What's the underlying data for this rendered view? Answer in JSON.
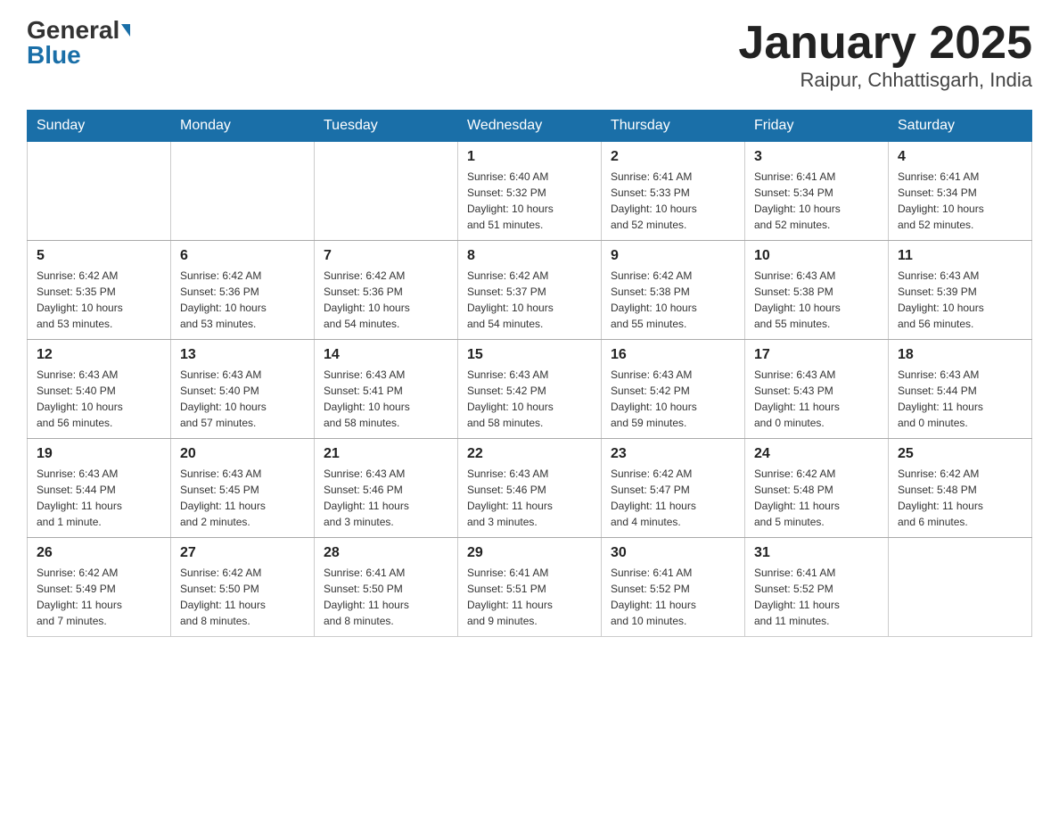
{
  "header": {
    "logo_general": "General",
    "logo_blue": "Blue",
    "title": "January 2025",
    "subtitle": "Raipur, Chhattisgarh, India"
  },
  "weekdays": [
    "Sunday",
    "Monday",
    "Tuesday",
    "Wednesday",
    "Thursday",
    "Friday",
    "Saturday"
  ],
  "weeks": [
    [
      {
        "day": "",
        "info": ""
      },
      {
        "day": "",
        "info": ""
      },
      {
        "day": "",
        "info": ""
      },
      {
        "day": "1",
        "info": "Sunrise: 6:40 AM\nSunset: 5:32 PM\nDaylight: 10 hours\nand 51 minutes."
      },
      {
        "day": "2",
        "info": "Sunrise: 6:41 AM\nSunset: 5:33 PM\nDaylight: 10 hours\nand 52 minutes."
      },
      {
        "day": "3",
        "info": "Sunrise: 6:41 AM\nSunset: 5:34 PM\nDaylight: 10 hours\nand 52 minutes."
      },
      {
        "day": "4",
        "info": "Sunrise: 6:41 AM\nSunset: 5:34 PM\nDaylight: 10 hours\nand 52 minutes."
      }
    ],
    [
      {
        "day": "5",
        "info": "Sunrise: 6:42 AM\nSunset: 5:35 PM\nDaylight: 10 hours\nand 53 minutes."
      },
      {
        "day": "6",
        "info": "Sunrise: 6:42 AM\nSunset: 5:36 PM\nDaylight: 10 hours\nand 53 minutes."
      },
      {
        "day": "7",
        "info": "Sunrise: 6:42 AM\nSunset: 5:36 PM\nDaylight: 10 hours\nand 54 minutes."
      },
      {
        "day": "8",
        "info": "Sunrise: 6:42 AM\nSunset: 5:37 PM\nDaylight: 10 hours\nand 54 minutes."
      },
      {
        "day": "9",
        "info": "Sunrise: 6:42 AM\nSunset: 5:38 PM\nDaylight: 10 hours\nand 55 minutes."
      },
      {
        "day": "10",
        "info": "Sunrise: 6:43 AM\nSunset: 5:38 PM\nDaylight: 10 hours\nand 55 minutes."
      },
      {
        "day": "11",
        "info": "Sunrise: 6:43 AM\nSunset: 5:39 PM\nDaylight: 10 hours\nand 56 minutes."
      }
    ],
    [
      {
        "day": "12",
        "info": "Sunrise: 6:43 AM\nSunset: 5:40 PM\nDaylight: 10 hours\nand 56 minutes."
      },
      {
        "day": "13",
        "info": "Sunrise: 6:43 AM\nSunset: 5:40 PM\nDaylight: 10 hours\nand 57 minutes."
      },
      {
        "day": "14",
        "info": "Sunrise: 6:43 AM\nSunset: 5:41 PM\nDaylight: 10 hours\nand 58 minutes."
      },
      {
        "day": "15",
        "info": "Sunrise: 6:43 AM\nSunset: 5:42 PM\nDaylight: 10 hours\nand 58 minutes."
      },
      {
        "day": "16",
        "info": "Sunrise: 6:43 AM\nSunset: 5:42 PM\nDaylight: 10 hours\nand 59 minutes."
      },
      {
        "day": "17",
        "info": "Sunrise: 6:43 AM\nSunset: 5:43 PM\nDaylight: 11 hours\nand 0 minutes."
      },
      {
        "day": "18",
        "info": "Sunrise: 6:43 AM\nSunset: 5:44 PM\nDaylight: 11 hours\nand 0 minutes."
      }
    ],
    [
      {
        "day": "19",
        "info": "Sunrise: 6:43 AM\nSunset: 5:44 PM\nDaylight: 11 hours\nand 1 minute."
      },
      {
        "day": "20",
        "info": "Sunrise: 6:43 AM\nSunset: 5:45 PM\nDaylight: 11 hours\nand 2 minutes."
      },
      {
        "day": "21",
        "info": "Sunrise: 6:43 AM\nSunset: 5:46 PM\nDaylight: 11 hours\nand 3 minutes."
      },
      {
        "day": "22",
        "info": "Sunrise: 6:43 AM\nSunset: 5:46 PM\nDaylight: 11 hours\nand 3 minutes."
      },
      {
        "day": "23",
        "info": "Sunrise: 6:42 AM\nSunset: 5:47 PM\nDaylight: 11 hours\nand 4 minutes."
      },
      {
        "day": "24",
        "info": "Sunrise: 6:42 AM\nSunset: 5:48 PM\nDaylight: 11 hours\nand 5 minutes."
      },
      {
        "day": "25",
        "info": "Sunrise: 6:42 AM\nSunset: 5:48 PM\nDaylight: 11 hours\nand 6 minutes."
      }
    ],
    [
      {
        "day": "26",
        "info": "Sunrise: 6:42 AM\nSunset: 5:49 PM\nDaylight: 11 hours\nand 7 minutes."
      },
      {
        "day": "27",
        "info": "Sunrise: 6:42 AM\nSunset: 5:50 PM\nDaylight: 11 hours\nand 8 minutes."
      },
      {
        "day": "28",
        "info": "Sunrise: 6:41 AM\nSunset: 5:50 PM\nDaylight: 11 hours\nand 8 minutes."
      },
      {
        "day": "29",
        "info": "Sunrise: 6:41 AM\nSunset: 5:51 PM\nDaylight: 11 hours\nand 9 minutes."
      },
      {
        "day": "30",
        "info": "Sunrise: 6:41 AM\nSunset: 5:52 PM\nDaylight: 11 hours\nand 10 minutes."
      },
      {
        "day": "31",
        "info": "Sunrise: 6:41 AM\nSunset: 5:52 PM\nDaylight: 11 hours\nand 11 minutes."
      },
      {
        "day": "",
        "info": ""
      }
    ]
  ]
}
